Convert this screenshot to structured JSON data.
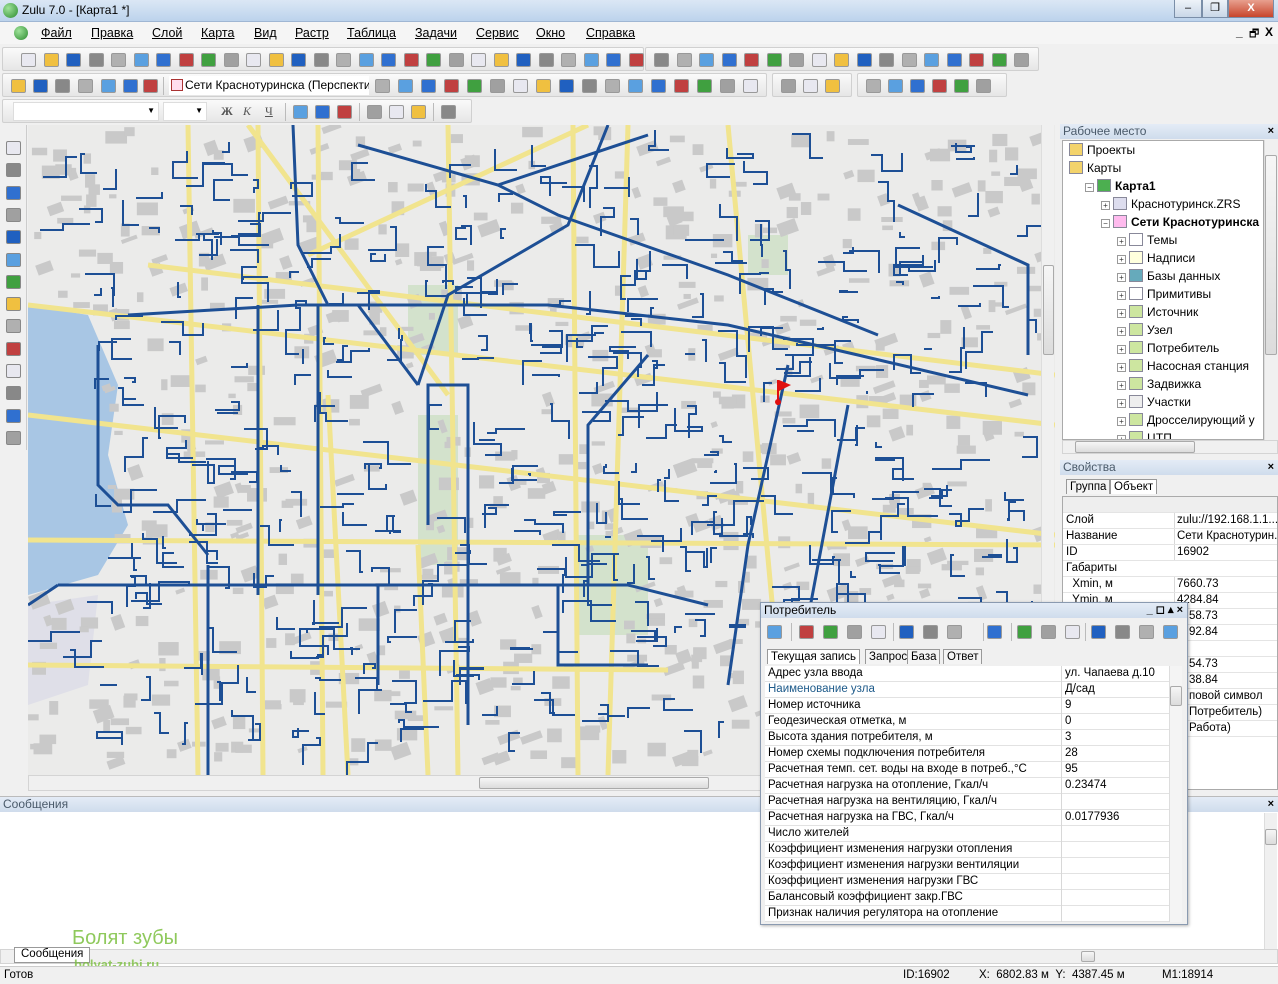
{
  "window": {
    "title": "Zulu 7.0 - [Карта1 *]",
    "min": "–",
    "max": "❐",
    "close": "X",
    "mdi_min": "_",
    "mdi_restore": "🗗",
    "mdi_close": "X"
  },
  "menu": [
    "Файл",
    "Правка",
    "Слой",
    "Карта",
    "Вид",
    "Растр",
    "Таблица",
    "Задачи",
    "Сервис",
    "Окно",
    "Справка"
  ],
  "toolbar2": {
    "layer_combo": "Сети Краснотуринска (Перспекти"
  },
  "toolbar3": {
    "bold": "Ж",
    "italic": "К",
    "underline": "Ч"
  },
  "colors": {
    "network": "#1d4f95",
    "road": "#f1e48e",
    "building": "#c9c9c9",
    "water": "#a8c6e4",
    "park": "#d3e2cc",
    "flag": "#e01010"
  },
  "workspace": {
    "title": "Рабочее место",
    "close": "×",
    "items": [
      {
        "label": "Проекты",
        "bold": false,
        "level": 1,
        "icon": "folder-icon"
      },
      {
        "label": "Карты",
        "bold": false,
        "level": 1,
        "icon": "folder-open-icon"
      },
      {
        "label": "Карта1",
        "bold": true,
        "level": 2,
        "icon": "globe-icon"
      },
      {
        "label": "Краснотуринск.ZRS",
        "bold": false,
        "level": 3,
        "icon": "raster-icon"
      },
      {
        "label": "Сети Краснотуринска",
        "bold": true,
        "level": 3,
        "icon": "layer-icon"
      },
      {
        "label": "Темы",
        "bold": false,
        "level": 4,
        "icon": "themes-icon"
      },
      {
        "label": "Надписи",
        "bold": false,
        "level": 4,
        "icon": "labels-icon"
      },
      {
        "label": "Базы данных",
        "bold": false,
        "level": 4,
        "icon": "database-icon"
      },
      {
        "label": "Примитивы",
        "bold": false,
        "level": 4,
        "icon": "primitives-icon"
      },
      {
        "label": "Источник",
        "bold": false,
        "level": 4,
        "icon": "type-icon"
      },
      {
        "label": "Узел",
        "bold": false,
        "level": 4,
        "icon": "type-icon"
      },
      {
        "label": "Потребитель",
        "bold": false,
        "level": 4,
        "icon": "type-icon"
      },
      {
        "label": "Насосная станция",
        "bold": false,
        "level": 4,
        "icon": "type-icon"
      },
      {
        "label": "Задвижка",
        "bold": false,
        "level": 4,
        "icon": "type-icon"
      },
      {
        "label": "Участки",
        "bold": false,
        "level": 4,
        "icon": "line-type-icon"
      },
      {
        "label": "Дросселирующий у",
        "bold": false,
        "level": 4,
        "icon": "type-icon"
      },
      {
        "label": "ЦТП",
        "bold": false,
        "level": 4,
        "icon": "type-icon"
      }
    ]
  },
  "properties": {
    "title": "Свойства",
    "close": "×",
    "tabs": [
      "Группа",
      "Объект"
    ],
    "rows": [
      {
        "k": "Слой",
        "v": "zulu://192.168.1.1..."
      },
      {
        "k": "Название",
        "v": "Сети Краснотурин..."
      },
      {
        "k": "ID",
        "v": "16902"
      },
      {
        "k": "Габариты",
        "v": ""
      },
      {
        "k": "  Xmin, м",
        "v": "7660.73"
      },
      {
        "k": "  Ymin, м",
        "v": "4284.84"
      },
      {
        "k": "",
        "v": "58.73"
      },
      {
        "k": "",
        "v": "92.84"
      },
      {
        "k": "",
        "v": ""
      },
      {
        "k": "",
        "v": "54.73"
      },
      {
        "k": "",
        "v": "38.84"
      },
      {
        "k": "",
        "v": "повой символ"
      },
      {
        "k": "",
        "v": "Потребитель)"
      },
      {
        "k": "",
        "v": "Работа)"
      }
    ]
  },
  "messages": {
    "title": "Сообщения",
    "tab": "Сообщения",
    "watermark": "Болят зубы",
    "watermark_url": "bolyat-zubi.ru"
  },
  "popup": {
    "title": "Потребитель",
    "tabs": [
      "Текущая запись",
      "Запрос",
      "База",
      "Ответ"
    ],
    "rows": [
      {
        "k": "Адрес узла ввода",
        "v": "ул. Чапаева д.10"
      },
      {
        "k": "Наименование узла",
        "v": "Д/сад",
        "highlight": true
      },
      {
        "k": "Номер источника",
        "v": "9"
      },
      {
        "k": "Геодезическая отметка, м",
        "v": "0"
      },
      {
        "k": "Высота здания потребителя, м",
        "v": "3"
      },
      {
        "k": "Номер схемы подключения потребителя",
        "v": "28"
      },
      {
        "k": "Расчетная темп. сет. воды на входе в потреб.,°С",
        "v": "95"
      },
      {
        "k": "Расчетная нагрузка на отопление, Гкал/ч",
        "v": "0.23474"
      },
      {
        "k": "Расчетная нагрузка на вентиляцию, Гкал/ч",
        "v": ""
      },
      {
        "k": "Расчетная нагрузка на ГВС, Гкал/ч",
        "v": "0.0177936"
      },
      {
        "k": "Число жителей",
        "v": ""
      },
      {
        "k": "Коэффициент изменения нагрузки отопления",
        "v": ""
      },
      {
        "k": "Коэффициент изменения нагрузки вентиляции",
        "v": ""
      },
      {
        "k": "Коэффициент изменения нагрузки ГВС",
        "v": ""
      },
      {
        "k": "Балансовый коэффициент закр.ГВС",
        "v": ""
      },
      {
        "k": "Признак наличия регулятора на отопление",
        "v": ""
      }
    ]
  },
  "status": {
    "ready": "Готов",
    "id": "ID:16902",
    "coords": "X:  6802.83 м  Y:  4387.45 м",
    "scale": "М1:18914"
  }
}
